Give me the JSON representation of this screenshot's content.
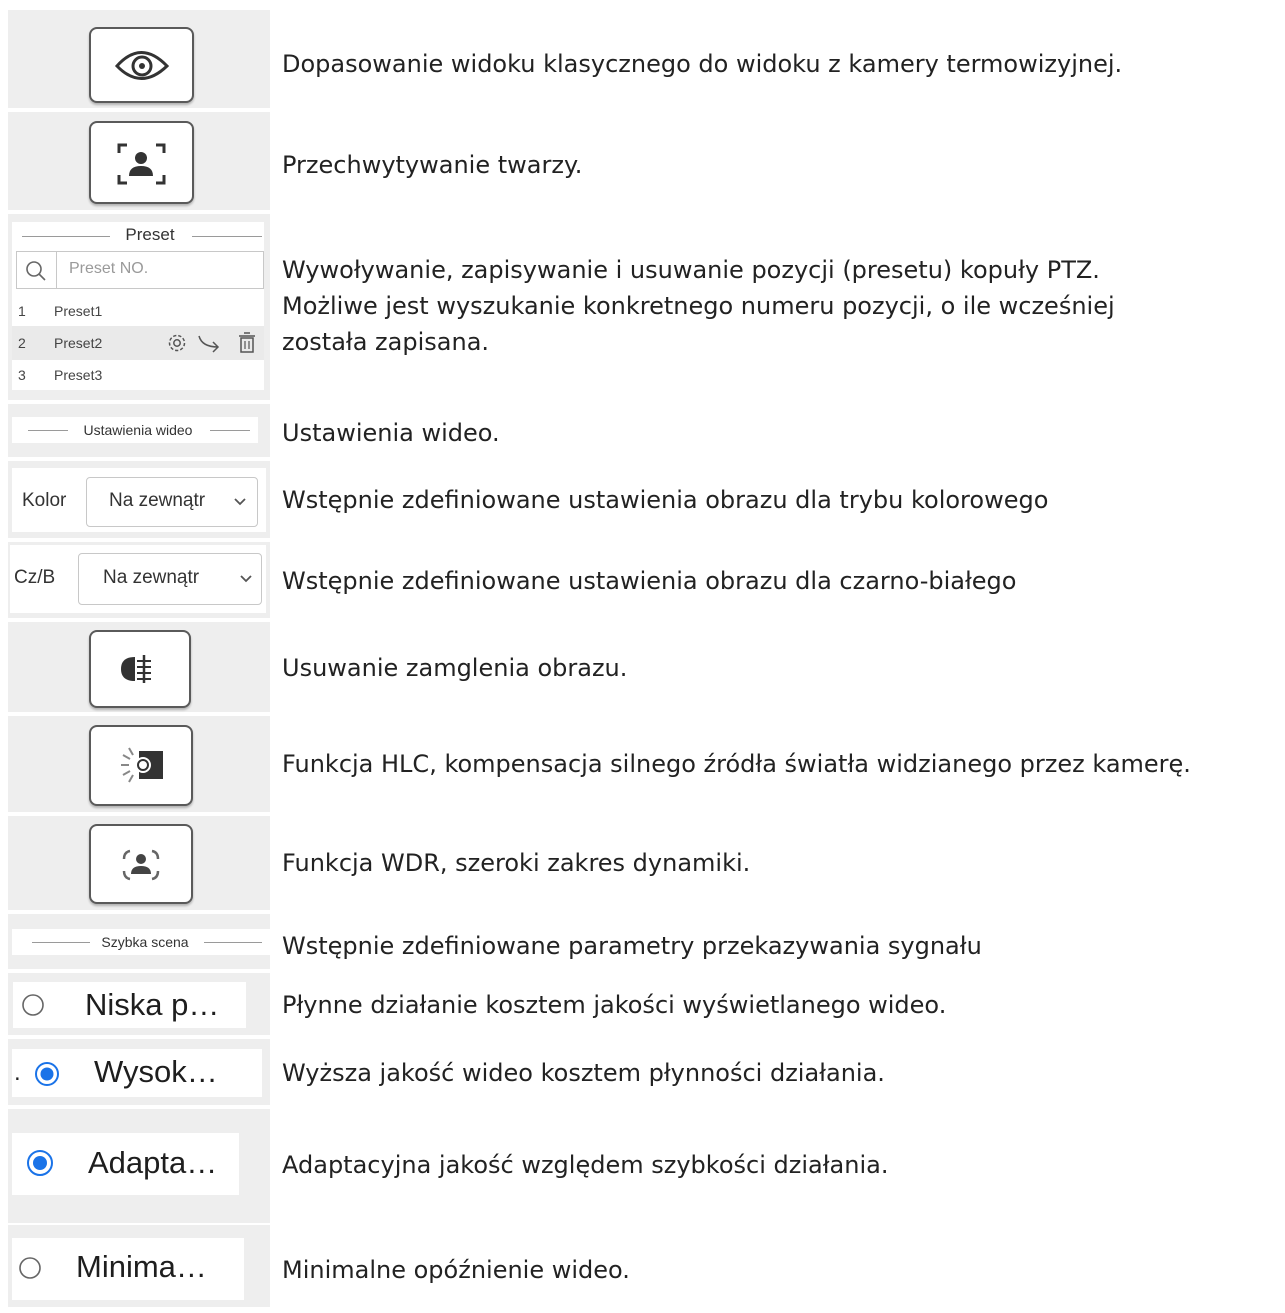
{
  "rows": [
    {
      "icon": "eye-icon",
      "desc": "Dopasowanie widoku klasycznego do widoku z kamery termowizyjnej."
    },
    {
      "icon": "face-capture-icon",
      "desc": "Przechwytywanie twarzy."
    },
    {
      "desc_lines": [
        "Wywoływanie, zapisywanie i usuwanie pozycji (presetu) kopuły PTZ.",
        "Możliwe jest wyszukanie konkretnego numeru pozycji, o ile wcześniej",
        "została zapisana."
      ]
    },
    {
      "desc": "Ustawienia wideo."
    },
    {
      "desc": "Wstępnie zdefiniowane ustawienia obrazu dla trybu kolorowego"
    },
    {
      "desc": "Wstępnie zdefiniowane ustawienia obrazu dla czarno-białego"
    },
    {
      "icon": "defog-icon",
      "desc": "Usuwanie zamglenia obrazu."
    },
    {
      "icon": "hlc-icon",
      "desc": "Funkcja HLC, kompensacja silnego źródła światła widzianego przez kamerę."
    },
    {
      "icon": "wdr-icon",
      "desc": "Funkcja WDR, szeroki zakres dynamiki."
    },
    {
      "desc": "Wstępnie zdefiniowane parametry przekazywania sygnału"
    },
    {
      "desc": "Płynne działanie kosztem jakości wyświetlanego wideo."
    },
    {
      "desc": "Wyższa jakość wideo kosztem płynności działania."
    },
    {
      "desc": "Adaptacyjna jakość względem szybkości działania."
    },
    {
      "desc": "Minimalne opóźnienie wideo."
    }
  ],
  "preset_panel": {
    "title": "Preset",
    "search_placeholder": "Preset NO.",
    "items": [
      {
        "num": "1",
        "name": "Preset1"
      },
      {
        "num": "2",
        "name": "Preset2",
        "selected": true
      },
      {
        "num": "3",
        "name": "Preset3"
      }
    ]
  },
  "video_settings": {
    "title": "Ustawienia wideo"
  },
  "color_select": {
    "label": "Kolor",
    "value": "Na zewnątr"
  },
  "bw_select": {
    "label": "Cz/B",
    "value": "Na zewnątr"
  },
  "quick_scene": {
    "title": "Szybka scena"
  },
  "radios": [
    {
      "label": "Niska p…",
      "checked": false
    },
    {
      "label": "Wysok…",
      "checked": true
    },
    {
      "label": "Adapta…",
      "checked": true
    },
    {
      "label": "Minima…",
      "checked": false
    }
  ],
  "colors": {
    "accent": "#1a73e8",
    "cell_bg": "#eeeeee"
  }
}
